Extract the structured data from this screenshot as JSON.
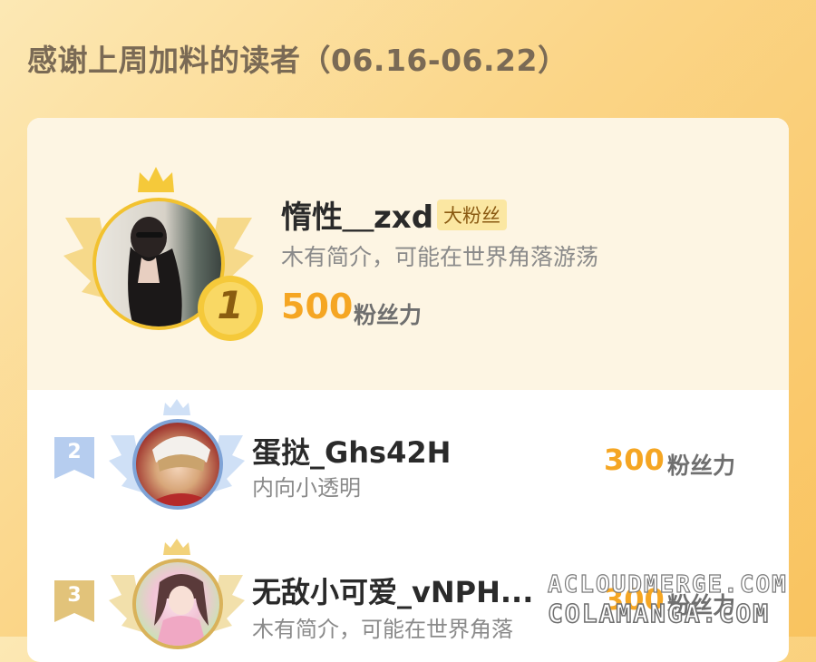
{
  "header": {
    "title": "感谢上周加料的读者（06.16-06.22）"
  },
  "top_reader": {
    "name": "惰性＿zxd",
    "badge": "大粉丝",
    "description": "木有简介，可能在世界角落游荡",
    "score": "500",
    "score_unit": "粉丝力",
    "rank": "1"
  },
  "readers": [
    {
      "rank": "2",
      "name": "蛋挞_Ghs42H",
      "description": "内向小透明",
      "score": "300",
      "score_unit": "粉丝力"
    },
    {
      "rank": "3",
      "name": "无敌小可爱_vNPH...",
      "description": "木有简介，可能在世界角落",
      "score": "300",
      "score_unit": "粉丝力"
    }
  ],
  "watermark": {
    "line1": "ACLOUDMERGE.COM",
    "line2": "COLAMANGA.COM"
  },
  "colors": {
    "accent": "#f5a623",
    "gold": "#f2c230",
    "silver": "#a9c3e6",
    "bronze": "#d9b25a"
  }
}
